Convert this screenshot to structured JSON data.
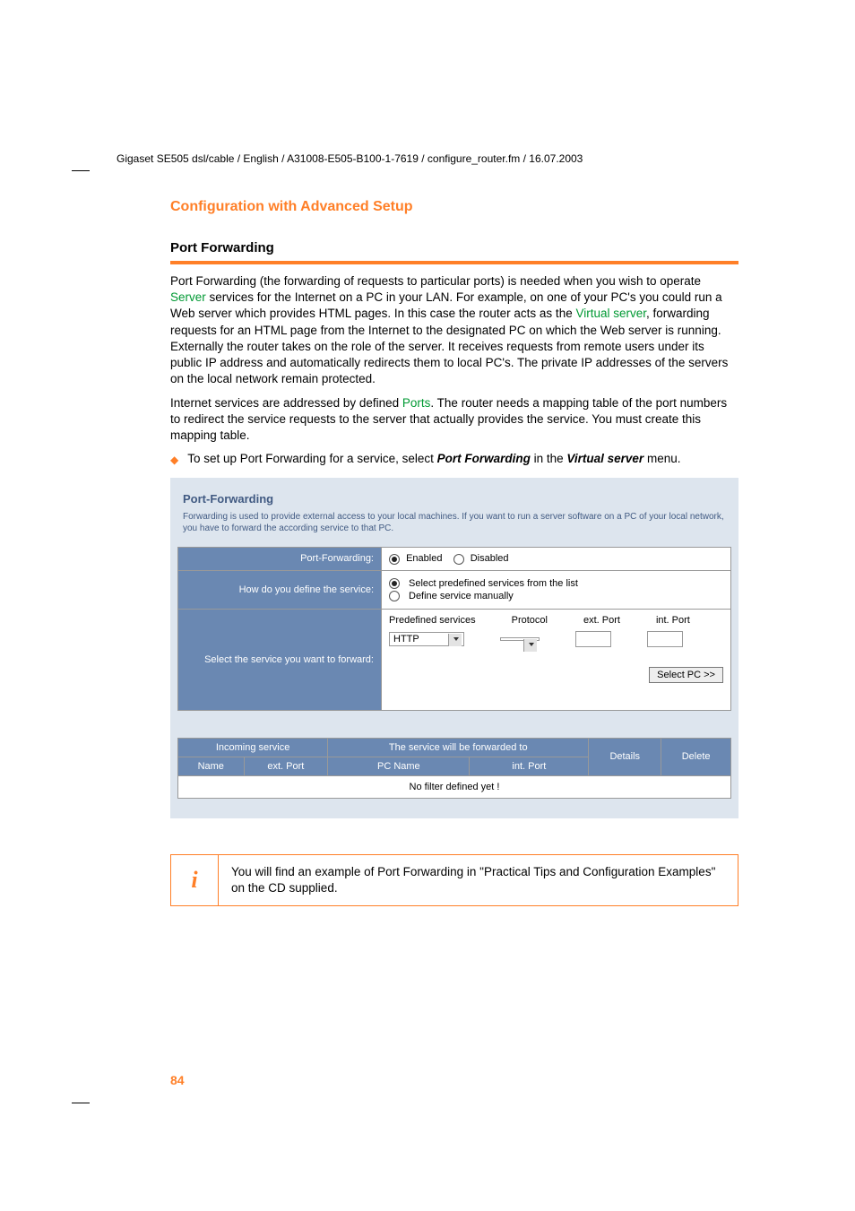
{
  "header_line": "Gigaset SE505 dsl/cable / English / A31008-E505-B100-1-7619 / configure_router.fm / 16.07.2003",
  "section_title": "Configuration with Advanced Setup",
  "subsection_title": "Port Forwarding",
  "para1_a": "Port Forwarding (the forwarding of requests to particular ports) is needed when you wish to operate ",
  "para1_link1": "Server",
  "para1_b": " services for the Internet on a PC in your LAN. For example, on one of your PC's you could run a Web server which provides HTML pages. In this case the router acts as the ",
  "para1_link2": "Virtual server",
  "para1_c": ", forwarding requests for an HTML page from the Internet to the designated PC on which the Web server is running. Externally the router takes on the role of the server. It receives requests from remote users under its public IP address and automatically redirects them to local PC's. The private IP addresses of the servers on the local network remain protected.",
  "para2_a": "Internet services are addressed by defined ",
  "para2_link1": "Ports",
  "para2_b": ". The router needs a mapping table of the port numbers to redirect the service requests to the server that actually provides the service. You must create this mapping table.",
  "bullet_a": "To set up Port Forwarding for a service, select ",
  "bullet_bold1": "Port Forwarding",
  "bullet_b": " in the ",
  "bullet_bold2": "Virtual server",
  "bullet_c": " menu.",
  "panel": {
    "title": "Port-Forwarding",
    "desc": "Forwarding is used to provide external access to your local machines. If you want to run a server software on a PC of your local network, you have to forward the according service to that PC.",
    "row1_label": "Port-Forwarding:",
    "row1_opt1": "Enabled",
    "row1_opt2": "Disabled",
    "row2_label": "How do you define the service:",
    "row2_opt1": "Select predefined services from the list",
    "row2_opt2": "Define service manually",
    "row3_label": "Select the service you want to forward:",
    "col_predef": "Predefined services",
    "col_protocol": "Protocol",
    "col_ext": "ext. Port",
    "col_int": "int. Port",
    "select_value": "HTTP",
    "btn_selectpc": "Select PC >>",
    "lt_incoming": "Incoming service",
    "lt_forwarded": "The service will be forwarded to",
    "lt_details": "Details",
    "lt_delete": "Delete",
    "lt_name": "Name",
    "lt_extport": "ext. Port",
    "lt_pcname": "PC Name",
    "lt_intport": "int. Port",
    "lt_empty": "No filter defined yet !"
  },
  "info_text": "You will find an example of Port Forwarding in \"Practical Tips and Configuration Examples\" on the CD supplied.",
  "page_number": "84"
}
